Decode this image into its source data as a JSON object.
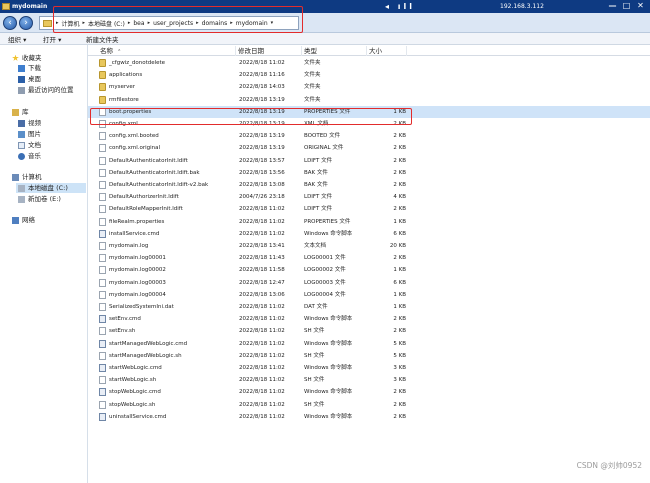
{
  "window": {
    "title": "mydomain",
    "ip": "192.168.3.112",
    "connection_icons": "◂ ıll",
    "buttons": [
      "—",
      "□",
      "✕"
    ]
  },
  "address": {
    "segments": [
      "计算机",
      "本地磁盘 (C:)",
      "bea",
      "user_projects",
      "domains",
      "mydomain"
    ],
    "separator": "▸",
    "dropdown": "▾"
  },
  "toolbar": {
    "organize": "组织 ▾",
    "open": "打开 ▾",
    "new_folder": "新建文件夹"
  },
  "sidebar": {
    "favorites": "收藏夹",
    "downloads": "下载",
    "desktop": "桌面",
    "recent": "最近访问的位置",
    "libraries": "库",
    "videos": "视频",
    "pictures": "图片",
    "documents": "文档",
    "music": "音乐",
    "computer": "计算机",
    "local_disk": "本地磁盘 (C:)",
    "new_volume": "新加卷 (E:)",
    "network": "网络"
  },
  "columns": {
    "name": "名称",
    "sort_indicator": "⌃",
    "date": "修改日期",
    "type": "类型",
    "size": "大小"
  },
  "files": [
    {
      "name": "_cfgwiz_donotdelete",
      "date": "2022/8/18 11:02",
      "type": "文件夹",
      "size": "",
      "kind": "folder"
    },
    {
      "name": "applications",
      "date": "2022/8/18 11:16",
      "type": "文件夹",
      "size": "",
      "kind": "folder"
    },
    {
      "name": "myserver",
      "date": "2022/8/18 14:03",
      "type": "文件夹",
      "size": "",
      "kind": "folder"
    },
    {
      "name": "rmfilestore",
      "date": "2022/8/18 13:19",
      "type": "文件夹",
      "size": "",
      "kind": "folder"
    },
    {
      "name": "boot.properties",
      "date": "2022/8/18 13:19",
      "type": "PROPERTIES 文件",
      "size": "1 KB",
      "kind": "file"
    },
    {
      "name": "config.xml",
      "date": "2022/8/18 13:19",
      "type": "XML 文档",
      "size": "2 KB",
      "kind": "file"
    },
    {
      "name": "config.xml.booted",
      "date": "2022/8/18 13:19",
      "type": "BOOTED 文件",
      "size": "2 KB",
      "kind": "file"
    },
    {
      "name": "config.xml.original",
      "date": "2022/8/18 13:19",
      "type": "ORIGINAL 文件",
      "size": "2 KB",
      "kind": "file"
    },
    {
      "name": "DefaultAuthenticatorInit.ldift",
      "date": "2022/8/18 13:57",
      "type": "LDIFT 文件",
      "size": "2 KB",
      "kind": "file"
    },
    {
      "name": "DefaultAuthenticatorInit.ldift.bak",
      "date": "2022/8/18 13:56",
      "type": "BAK 文件",
      "size": "2 KB",
      "kind": "file"
    },
    {
      "name": "DefaultAuthenticatorInit.ldift-v2.bak",
      "date": "2022/8/18 13:08",
      "type": "BAK 文件",
      "size": "2 KB",
      "kind": "file"
    },
    {
      "name": "DefaultAuthorizerInit.ldift",
      "date": "2004/7/26 23:18",
      "type": "LDIFT 文件",
      "size": "4 KB",
      "kind": "file"
    },
    {
      "name": "DefaultRoleMapperInit.ldift",
      "date": "2022/8/18 11:02",
      "type": "LDIFT 文件",
      "size": "2 KB",
      "kind": "file"
    },
    {
      "name": "fileRealm.properties",
      "date": "2022/8/18 11:02",
      "type": "PROPERTIES 文件",
      "size": "1 KB",
      "kind": "file"
    },
    {
      "name": "installService.cmd",
      "date": "2022/8/18 11:02",
      "type": "Windows 命令脚本",
      "size": "6 KB",
      "kind": "script"
    },
    {
      "name": "mydomain.log",
      "date": "2022/8/18 13:41",
      "type": "文本文档",
      "size": "20 KB",
      "kind": "file"
    },
    {
      "name": "mydomain.log00001",
      "date": "2022/8/18 11:43",
      "type": "LOG00001 文件",
      "size": "2 KB",
      "kind": "file"
    },
    {
      "name": "mydomain.log00002",
      "date": "2022/8/18 11:58",
      "type": "LOG00002 文件",
      "size": "1 KB",
      "kind": "file"
    },
    {
      "name": "mydomain.log00003",
      "date": "2022/8/18 12:47",
      "type": "LOG00003 文件",
      "size": "6 KB",
      "kind": "file"
    },
    {
      "name": "mydomain.log00004",
      "date": "2022/8/18 13:06",
      "type": "LOG00004 文件",
      "size": "1 KB",
      "kind": "file"
    },
    {
      "name": "SerializedSystemIni.dat",
      "date": "2022/8/18 11:02",
      "type": "DAT 文件",
      "size": "1 KB",
      "kind": "file"
    },
    {
      "name": "setEnv.cmd",
      "date": "2022/8/18 11:02",
      "type": "Windows 命令脚本",
      "size": "2 KB",
      "kind": "script"
    },
    {
      "name": "setEnv.sh",
      "date": "2022/8/18 11:02",
      "type": "SH 文件",
      "size": "2 KB",
      "kind": "file"
    },
    {
      "name": "startManagedWebLogic.cmd",
      "date": "2022/8/18 11:02",
      "type": "Windows 命令脚本",
      "size": "5 KB",
      "kind": "script"
    },
    {
      "name": "startManagedWebLogic.sh",
      "date": "2022/8/18 11:02",
      "type": "SH 文件",
      "size": "5 KB",
      "kind": "file"
    },
    {
      "name": "startWebLogic.cmd",
      "date": "2022/8/18 11:02",
      "type": "Windows 命令脚本",
      "size": "3 KB",
      "kind": "script"
    },
    {
      "name": "startWebLogic.sh",
      "date": "2022/8/18 11:02",
      "type": "SH 文件",
      "size": "3 KB",
      "kind": "file"
    },
    {
      "name": "stopWebLogic.cmd",
      "date": "2022/8/18 11:02",
      "type": "Windows 命令脚本",
      "size": "2 KB",
      "kind": "script"
    },
    {
      "name": "stopWebLogic.sh",
      "date": "2022/8/18 11:02",
      "type": "SH 文件",
      "size": "2 KB",
      "kind": "file"
    },
    {
      "name": "uninstallService.cmd",
      "date": "2022/8/18 11:02",
      "type": "Windows 命令脚本",
      "size": "2 KB",
      "kind": "script"
    }
  ],
  "selected_row": 4,
  "watermark": "CSDN @刘帅0952",
  "colors": {
    "titlebar": "#0e3a82",
    "highlight": "#e22c2c",
    "selection": "#cfe3f8"
  }
}
